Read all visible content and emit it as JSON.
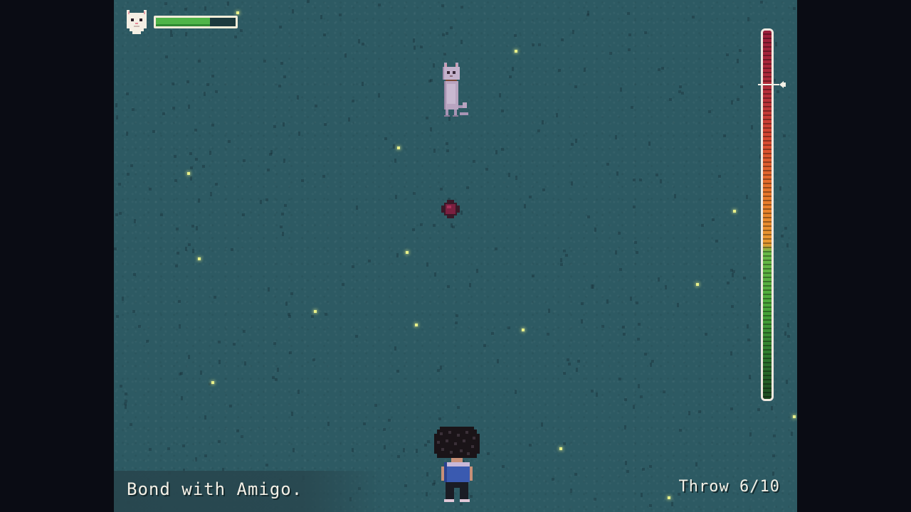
{
  "hud": {
    "health_fraction": 0.68,
    "health_color": "#4fb548",
    "icon": "cat-head-icon"
  },
  "power_meter": {
    "level_fraction": 0.85,
    "colors": {
      "high": "#9a1e3a",
      "mid": "#e8782a",
      "low": "#4aa83a"
    }
  },
  "objective": {
    "text": "Bond with Amigo."
  },
  "throw_counter": {
    "text": "Throw 6/10"
  },
  "colors": {
    "ground": "#2d5a63",
    "letterbox": "#0a0c14",
    "firefly": "#e8f08a",
    "text": "#f4f0e6"
  }
}
